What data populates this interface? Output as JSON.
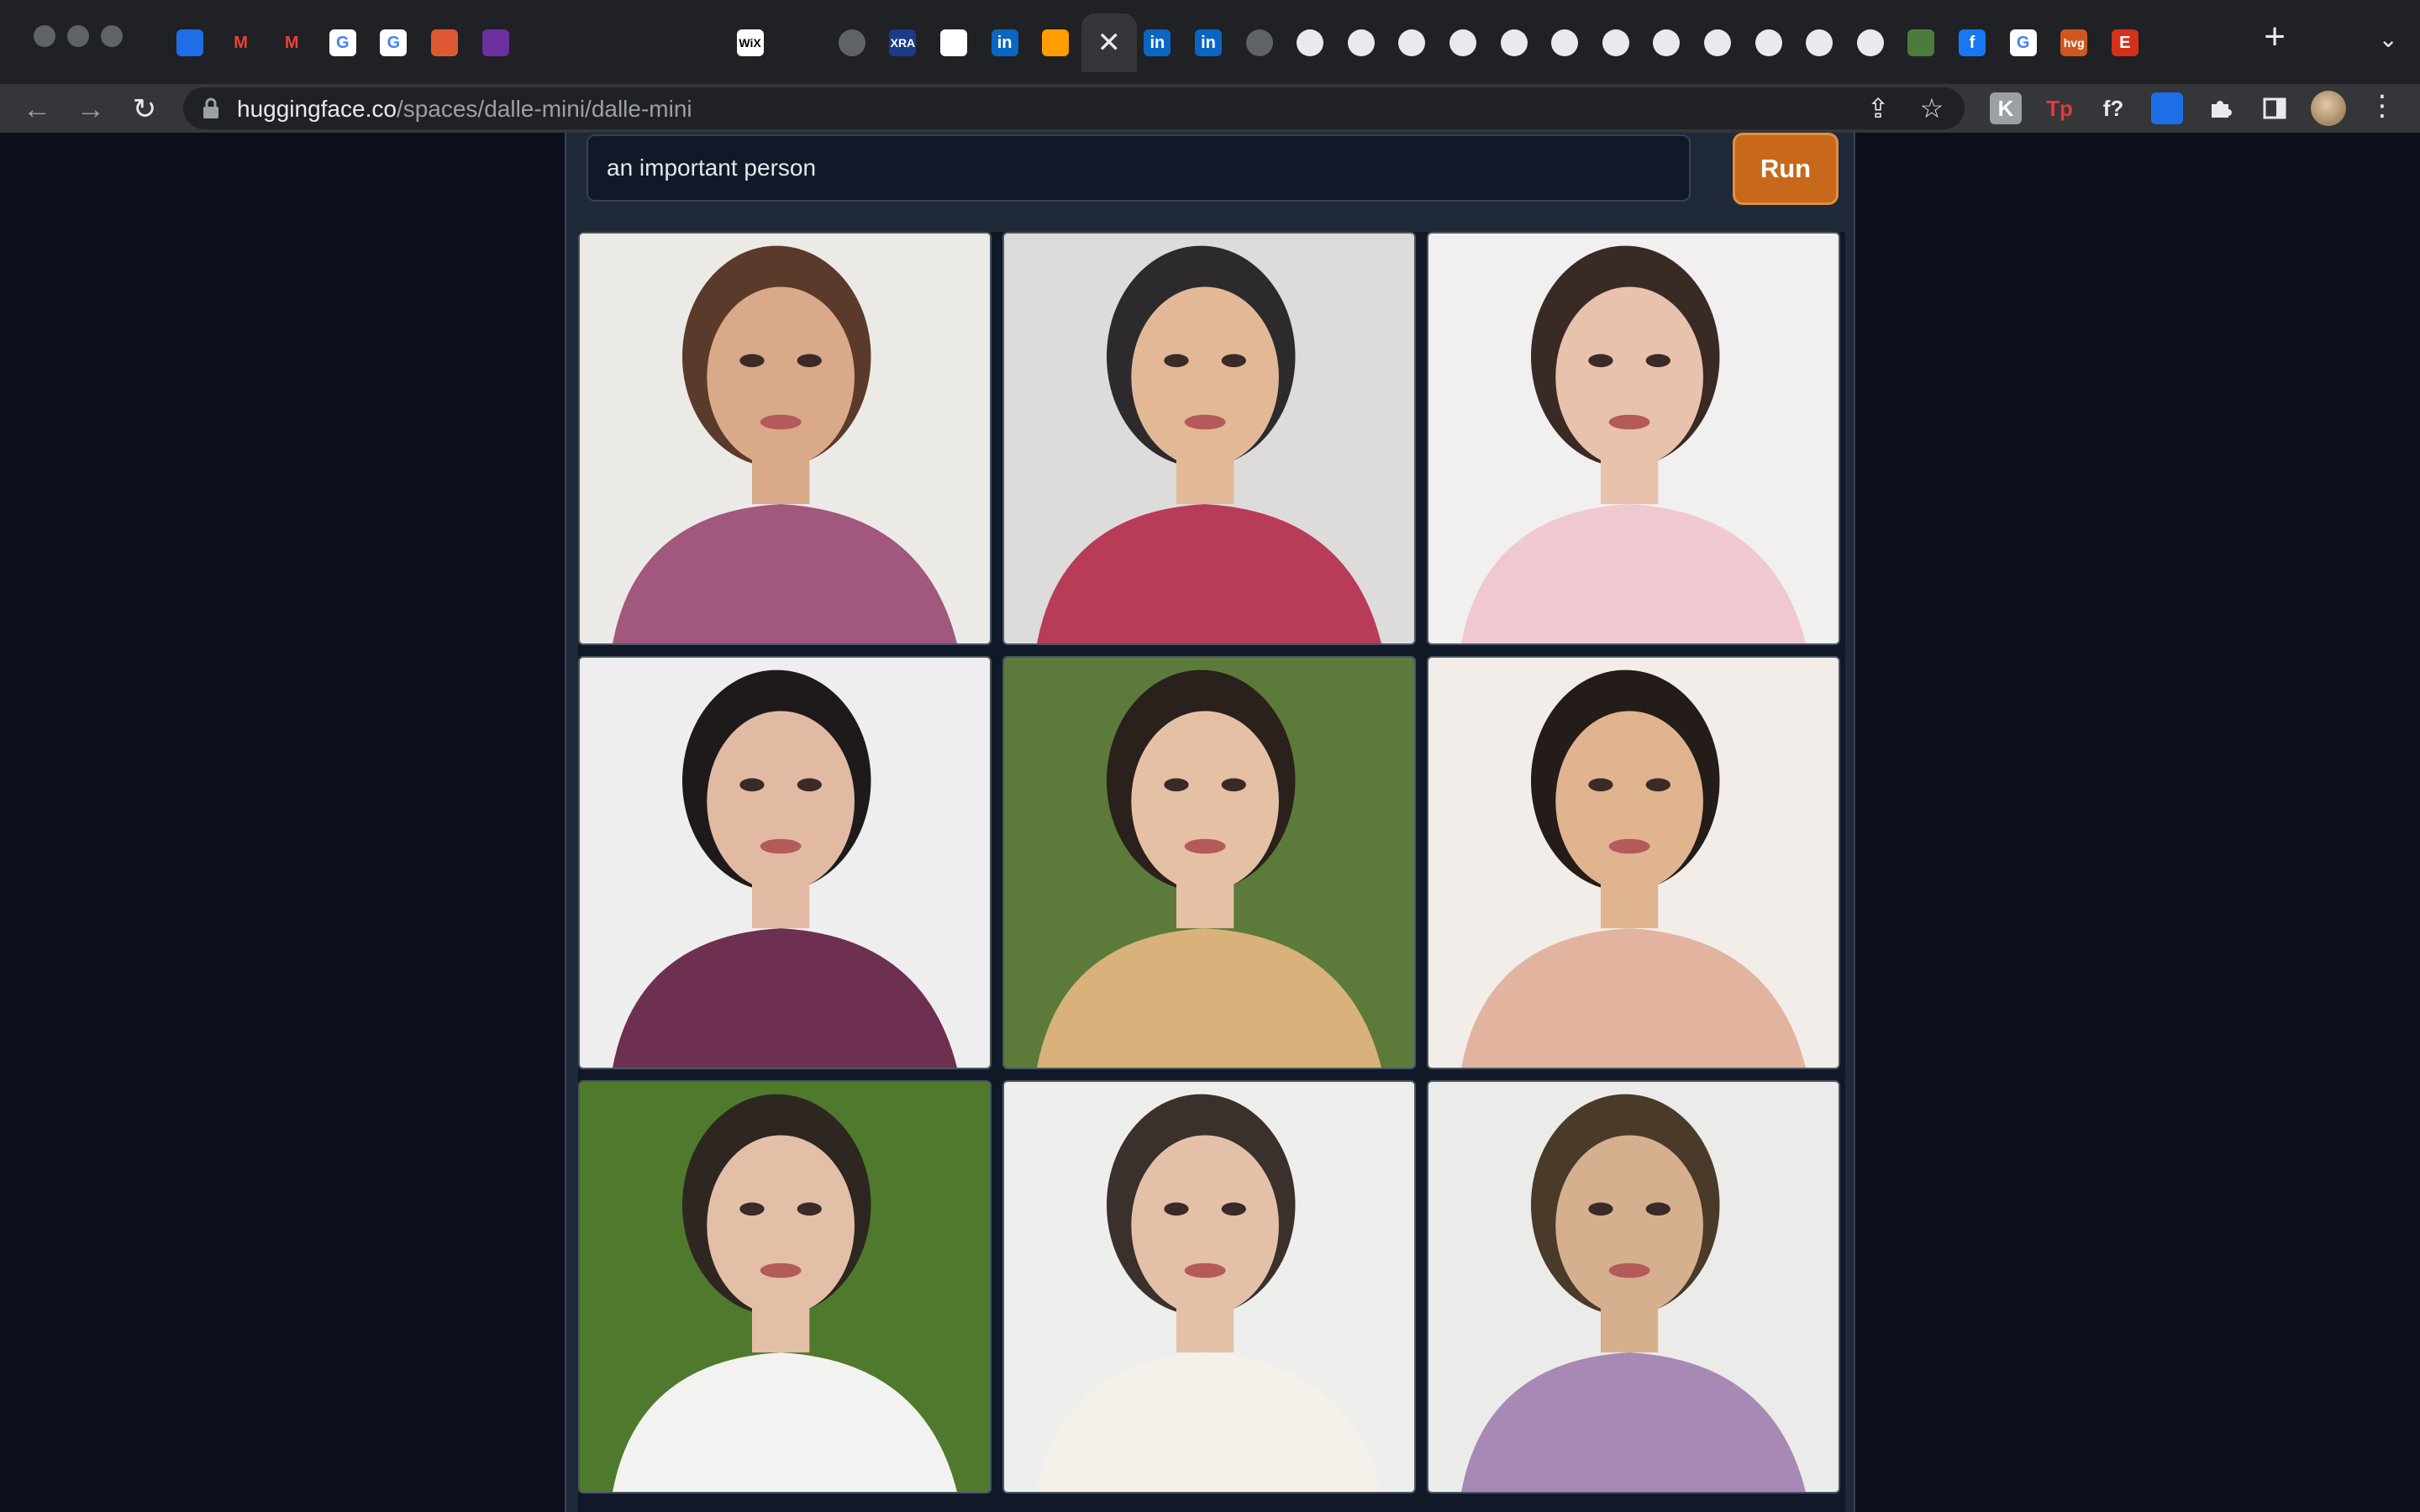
{
  "browser": {
    "url_host": "huggingface.co",
    "url_path": "/spaces/dalle-mini/dalle-mini",
    "new_tab_label": "+",
    "tab_list_label": "⌄",
    "tabs": [
      {
        "icon": "gem-icon",
        "label": ""
      },
      {
        "icon": "gmail-icon",
        "label": "M"
      },
      {
        "icon": "gmail-icon",
        "label": "M"
      },
      {
        "icon": "google-icon",
        "label": "G"
      },
      {
        "icon": "google-icon",
        "label": "G"
      },
      {
        "icon": "duckduckgo-icon",
        "label": ""
      },
      {
        "icon": "purple-app-icon",
        "label": ""
      },
      {
        "icon": "red-bookmark-icon",
        "label": ""
      },
      {
        "icon": "red-bookmark-icon",
        "label": ""
      },
      {
        "icon": "red-bookmark-icon",
        "label": ""
      },
      {
        "icon": "red-bookmark-icon",
        "label": ""
      },
      {
        "icon": "wix-icon",
        "label": "WiX"
      },
      {
        "icon": "blank-icon",
        "label": ""
      },
      {
        "icon": "globe-icon",
        "label": ""
      },
      {
        "icon": "xra-icon",
        "label": "XRA"
      },
      {
        "icon": "white-square-icon",
        "label": ""
      },
      {
        "icon": "linkedin-icon",
        "label": "in"
      },
      {
        "icon": "huggingface-icon",
        "label": ""
      },
      {
        "icon": "close-icon",
        "label": "✕",
        "active": true
      },
      {
        "icon": "linkedin-icon",
        "label": "in"
      },
      {
        "icon": "linkedin-icon",
        "label": "in"
      },
      {
        "icon": "globe-icon",
        "label": ""
      },
      {
        "icon": "gear-icon",
        "label": ""
      },
      {
        "icon": "gear-icon",
        "label": ""
      },
      {
        "icon": "gear-icon",
        "label": ""
      },
      {
        "icon": "gear-icon",
        "label": ""
      },
      {
        "icon": "gear-icon",
        "label": ""
      },
      {
        "icon": "gear-icon",
        "label": ""
      },
      {
        "icon": "gear-icon",
        "label": ""
      },
      {
        "icon": "gear-icon",
        "label": ""
      },
      {
        "icon": "gear-icon",
        "label": ""
      },
      {
        "icon": "gear-icon",
        "label": ""
      },
      {
        "icon": "gear-icon",
        "label": ""
      },
      {
        "icon": "github-icon",
        "label": ""
      },
      {
        "icon": "green-pill-icon",
        "label": ""
      },
      {
        "icon": "facebook-icon",
        "label": "f"
      },
      {
        "icon": "google-icon",
        "label": "G"
      },
      {
        "icon": "hvg-icon",
        "label": "hvg"
      },
      {
        "icon": "etsy-icon",
        "label": "E"
      }
    ],
    "extensions": [
      {
        "icon": "k-extension-icon",
        "label": "K"
      },
      {
        "icon": "tp-extension-icon",
        "label": "Tp"
      },
      {
        "icon": "f-question-extension-icon",
        "label": "f?"
      },
      {
        "icon": "gem-extension-icon",
        "label": ""
      },
      {
        "icon": "puzzle-icon",
        "label": ""
      },
      {
        "icon": "side-panel-icon",
        "label": ""
      }
    ]
  },
  "app": {
    "prompt_value": "an important person",
    "run_label": "Run",
    "images": [
      {
        "name": "generated-image-1",
        "bg": "#eceae6",
        "skin": "#d9a98a",
        "hair": "#5a3a2a",
        "shirt": "#a2577e"
      },
      {
        "name": "generated-image-2",
        "bg": "#dedcdb",
        "skin": "#e3b897",
        "hair": "#2c2a2c",
        "shirt": "#b83c58"
      },
      {
        "name": "generated-image-3",
        "bg": "#f1efef",
        "skin": "#e8c2ac",
        "hair": "#3a2a26",
        "shirt": "#f0c8d0"
      },
      {
        "name": "generated-image-4",
        "bg": "#eeeeee",
        "skin": "#e2baa4",
        "hair": "#1e1a1c",
        "shirt": "#6e3050"
      },
      {
        "name": "generated-image-5",
        "bg": "#5c7a3a",
        "skin": "#e6c0a4",
        "hair": "#2a201c",
        "shirt": "#d8b27a"
      },
      {
        "name": "generated-image-6",
        "bg": "#f2ede8",
        "skin": "#e0b48e",
        "hair": "#241c18",
        "shirt": "#e2b4a0"
      },
      {
        "name": "generated-image-7",
        "bg": "#4f7a2e",
        "skin": "#e4bfa8",
        "hair": "#2e2620",
        "shirt": "#f2f2f0"
      },
      {
        "name": "generated-image-8",
        "bg": "#eeeeec",
        "skin": "#e4c0a8",
        "hair": "#3a302c",
        "shirt": "#f4f0ea"
      },
      {
        "name": "generated-image-9",
        "bg": "#ebebe9",
        "skin": "#d6b08e",
        "hair": "#4a3a2a",
        "shirt": "#a888b4"
      }
    ]
  }
}
